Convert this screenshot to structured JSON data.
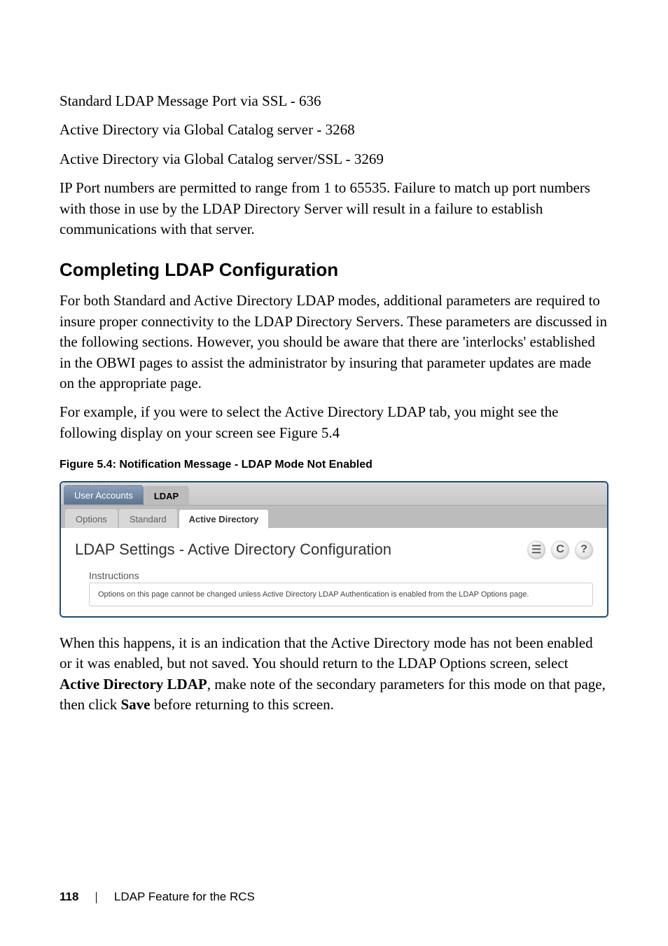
{
  "p1": "Standard LDAP Message Port via SSL - 636",
  "p2": "Active Directory via Global Catalog server - 3268",
  "p3": "Active Directory via Global Catalog server/SSL - 3269",
  "p4": "IP Port numbers are permitted to range from 1 to 65535. Failure to match up port numbers with those in use by the LDAP Directory Server will result in a failure to establish communications with that server.",
  "heading1": "Completing LDAP Configuration",
  "p5": "For both Standard and Active Directory LDAP modes, additional parameters are required to insure proper connectivity to the LDAP Directory Servers. These parameters are discussed in the following sections. However, you should be aware that there are 'interlocks' established in the OBWI pages to assist the administrator by insuring that parameter updates are made on the appropriate page.",
  "p6": "For example, if you were to select the Active Directory LDAP tab, you might see the following display on your screen see Figure 5.4",
  "figcaption": "Figure 5.4: Notification Message - LDAP Mode Not Enabled",
  "ui": {
    "primary_tabs": {
      "user_accounts": "User Accounts",
      "ldap": "LDAP"
    },
    "secondary_tabs": {
      "options": "Options",
      "standard": "Standard",
      "active_directory": "Active Directory"
    },
    "panel_title": "LDAP Settings - Active Directory Configuration",
    "icons": {
      "printer": "☰",
      "refresh": "C",
      "help": "?"
    },
    "instructions_title": "Instructions",
    "instructions_body": "Options on this page cannot be changed unless Active Directory LDAP Authentication is enabled from the LDAP Options page."
  },
  "p7a": "When this happens, it is an indication that the Active Directory mode has not been enabled or it was enabled, but not saved. You should return to the LDAP Options screen, select ",
  "p7b": "Active Directory LDAP",
  "p7c": ", make note of the secondary parameters for this mode on that page, then click ",
  "p7d": "Save",
  "p7e": " before returning to this screen.",
  "footer": {
    "page": "118",
    "chapter": "LDAP Feature for the RCS"
  }
}
